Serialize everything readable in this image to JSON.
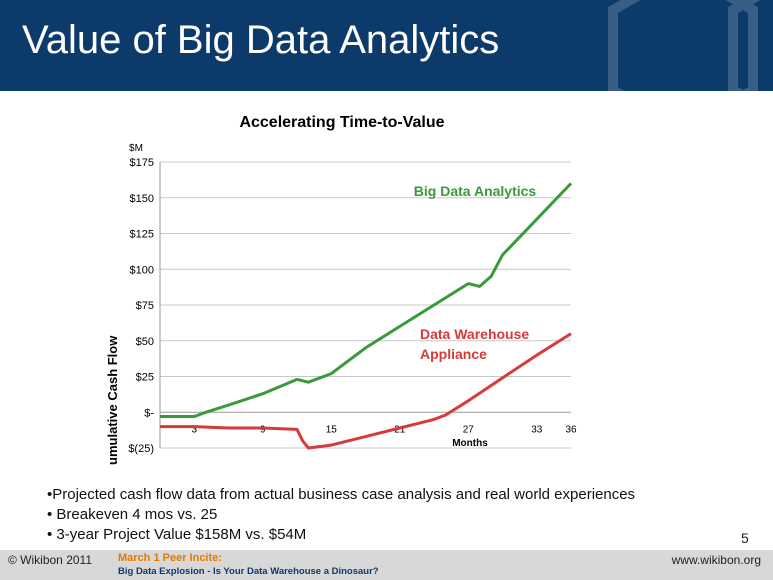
{
  "slide": {
    "title": "Value of Big Data Analytics",
    "number": "5",
    "bullets": [
      "•Projected cash flow data from actual business case analysis and real world experiences",
      "• Breakeven 4 mos vs. 25",
      "• 3-year Project Value $158M vs. $54M"
    ]
  },
  "footer": {
    "copyright": "© Wikibon 2011",
    "event": "March 1 Peer Incite:",
    "subtitle": "Big Data Explosion - Is Your Data Warehouse a Dinosaur?",
    "site": "www.wikibon.org"
  },
  "colors": {
    "header": "#0c3a6b",
    "big_data": "#3a9a3a",
    "warehouse": "#d63a3a"
  },
  "chart_data": {
    "type": "line",
    "title": "Accelerating Time-to-Value",
    "unit_label": "$M",
    "ylabel": "Cumulative Cash Flow",
    "xlabel": "Months",
    "ylim": [
      -25,
      175
    ],
    "xlim": [
      0,
      36
    ],
    "grid": true,
    "y_tick_values": [
      -25,
      0,
      25,
      50,
      75,
      100,
      125,
      150,
      175
    ],
    "y_tick_labels": [
      "$(25)",
      "$-",
      "$25",
      "$50",
      "$75",
      "$100",
      "$125",
      "$150",
      "$175"
    ],
    "x_tick_values": [
      3,
      9,
      15,
      21,
      27,
      33,
      36
    ],
    "x_tick_labels": [
      "3",
      "9",
      "15",
      "21",
      "27",
      "33",
      "36"
    ],
    "series": [
      {
        "name": "Big Data Analytics",
        "color": "#3a9a3a",
        "x": [
          0,
          3,
          4,
          6,
          9,
          12,
          13,
          15,
          18,
          21,
          24,
          27,
          28,
          29,
          30,
          33,
          36
        ],
        "y": [
          -3,
          -3,
          0,
          5,
          13,
          23,
          21,
          27,
          45,
          60,
          75,
          90,
          88,
          95,
          110,
          135,
          160
        ]
      },
      {
        "name": "Data Warehouse Appliance",
        "label_lines": [
          "Data Warehouse",
          "Appliance"
        ],
        "color": "#d63a3a",
        "x": [
          0,
          3,
          6,
          9,
          12,
          12.5,
          13,
          15,
          18,
          21,
          24,
          25,
          27,
          30,
          33,
          36
        ],
        "y": [
          -10,
          -10,
          -11,
          -11,
          -12,
          -20,
          -25,
          -23,
          -17,
          -11,
          -5,
          -2,
          8,
          24,
          40,
          55
        ]
      }
    ]
  }
}
